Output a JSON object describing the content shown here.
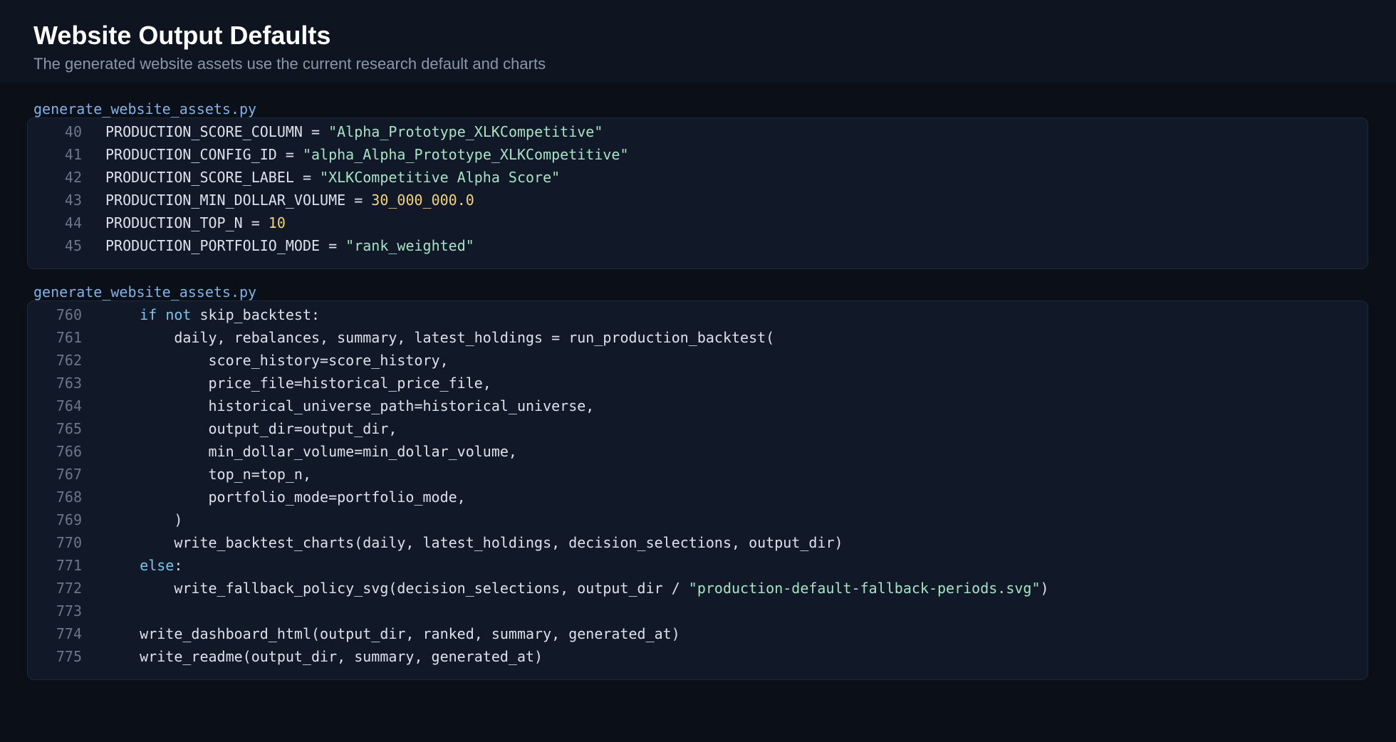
{
  "page": {
    "title": "Website Output Defaults",
    "subtitle": "The generated website assets use the current research default and charts"
  },
  "colors": {
    "background": "#0b0f17",
    "header_background": "#0e1420",
    "panel_background": "#111827",
    "file_label": "#7fb2e8",
    "string": "#a7e3c4",
    "number": "#f3d37c",
    "keyword": "#7cc4ee",
    "line_number": "#6b7689",
    "code_text": "#dbe2ec"
  },
  "snippets": [
    {
      "file": "generate_website_assets.py",
      "lines": [
        {
          "num": "40",
          "tokens": [
            {
              "t": "PRODUCTION_SCORE_COLUMN = ",
              "k": "plain"
            },
            {
              "t": "\"Alpha_Prototype_XLKCompetitive\"",
              "k": "str"
            }
          ]
        },
        {
          "num": "41",
          "tokens": [
            {
              "t": "PRODUCTION_CONFIG_ID = ",
              "k": "plain"
            },
            {
              "t": "\"alpha_Alpha_Prototype_XLKCompetitive\"",
              "k": "str"
            }
          ]
        },
        {
          "num": "42",
          "tokens": [
            {
              "t": "PRODUCTION_SCORE_LABEL = ",
              "k": "plain"
            },
            {
              "t": "\"XLKCompetitive Alpha Score\"",
              "k": "str"
            }
          ]
        },
        {
          "num": "43",
          "tokens": [
            {
              "t": "PRODUCTION_MIN_DOLLAR_VOLUME = ",
              "k": "plain"
            },
            {
              "t": "30_000_000.0",
              "k": "num"
            }
          ]
        },
        {
          "num": "44",
          "tokens": [
            {
              "t": "PRODUCTION_TOP_N = ",
              "k": "plain"
            },
            {
              "t": "10",
              "k": "num"
            }
          ]
        },
        {
          "num": "45",
          "tokens": [
            {
              "t": "PRODUCTION_PORTFOLIO_MODE = ",
              "k": "plain"
            },
            {
              "t": "\"rank_weighted\"",
              "k": "str"
            }
          ]
        }
      ]
    },
    {
      "file": "generate_website_assets.py",
      "lines": [
        {
          "num": "760",
          "tokens": [
            {
              "t": "    ",
              "k": "plain"
            },
            {
              "t": "if",
              "k": "kw"
            },
            {
              "t": " ",
              "k": "plain"
            },
            {
              "t": "not",
              "k": "kw"
            },
            {
              "t": " skip_backtest:",
              "k": "plain"
            }
          ]
        },
        {
          "num": "761",
          "tokens": [
            {
              "t": "        daily, rebalances, summary, latest_holdings = run_production_backtest(",
              "k": "plain"
            }
          ]
        },
        {
          "num": "762",
          "tokens": [
            {
              "t": "            score_history=score_history,",
              "k": "plain"
            }
          ]
        },
        {
          "num": "763",
          "tokens": [
            {
              "t": "            price_file=historical_price_file,",
              "k": "plain"
            }
          ]
        },
        {
          "num": "764",
          "tokens": [
            {
              "t": "            historical_universe_path=historical_universe,",
              "k": "plain"
            }
          ]
        },
        {
          "num": "765",
          "tokens": [
            {
              "t": "            output_dir=output_dir,",
              "k": "plain"
            }
          ]
        },
        {
          "num": "766",
          "tokens": [
            {
              "t": "            min_dollar_volume=min_dollar_volume,",
              "k": "plain"
            }
          ]
        },
        {
          "num": "767",
          "tokens": [
            {
              "t": "            top_n=top_n,",
              "k": "plain"
            }
          ]
        },
        {
          "num": "768",
          "tokens": [
            {
              "t": "            portfolio_mode=portfolio_mode,",
              "k": "plain"
            }
          ]
        },
        {
          "num": "769",
          "tokens": [
            {
              "t": "        )",
              "k": "plain"
            }
          ]
        },
        {
          "num": "770",
          "tokens": [
            {
              "t": "        write_backtest_charts(daily, latest_holdings, decision_selections, output_dir)",
              "k": "plain"
            }
          ]
        },
        {
          "num": "771",
          "tokens": [
            {
              "t": "    ",
              "k": "plain"
            },
            {
              "t": "else",
              "k": "kw"
            },
            {
              "t": ":",
              "k": "plain"
            }
          ]
        },
        {
          "num": "772",
          "tokens": [
            {
              "t": "        write_fallback_policy_svg(decision_selections, output_dir / ",
              "k": "plain"
            },
            {
              "t": "\"production-default-fallback-periods.svg\"",
              "k": "str"
            },
            {
              "t": ")",
              "k": "plain"
            }
          ]
        },
        {
          "num": "773",
          "tokens": []
        },
        {
          "num": "774",
          "tokens": [
            {
              "t": "    write_dashboard_html(output_dir, ranked, summary, generated_at)",
              "k": "plain"
            }
          ]
        },
        {
          "num": "775",
          "tokens": [
            {
              "t": "    write_readme(output_dir, summary, generated_at)",
              "k": "plain"
            }
          ]
        }
      ]
    }
  ]
}
